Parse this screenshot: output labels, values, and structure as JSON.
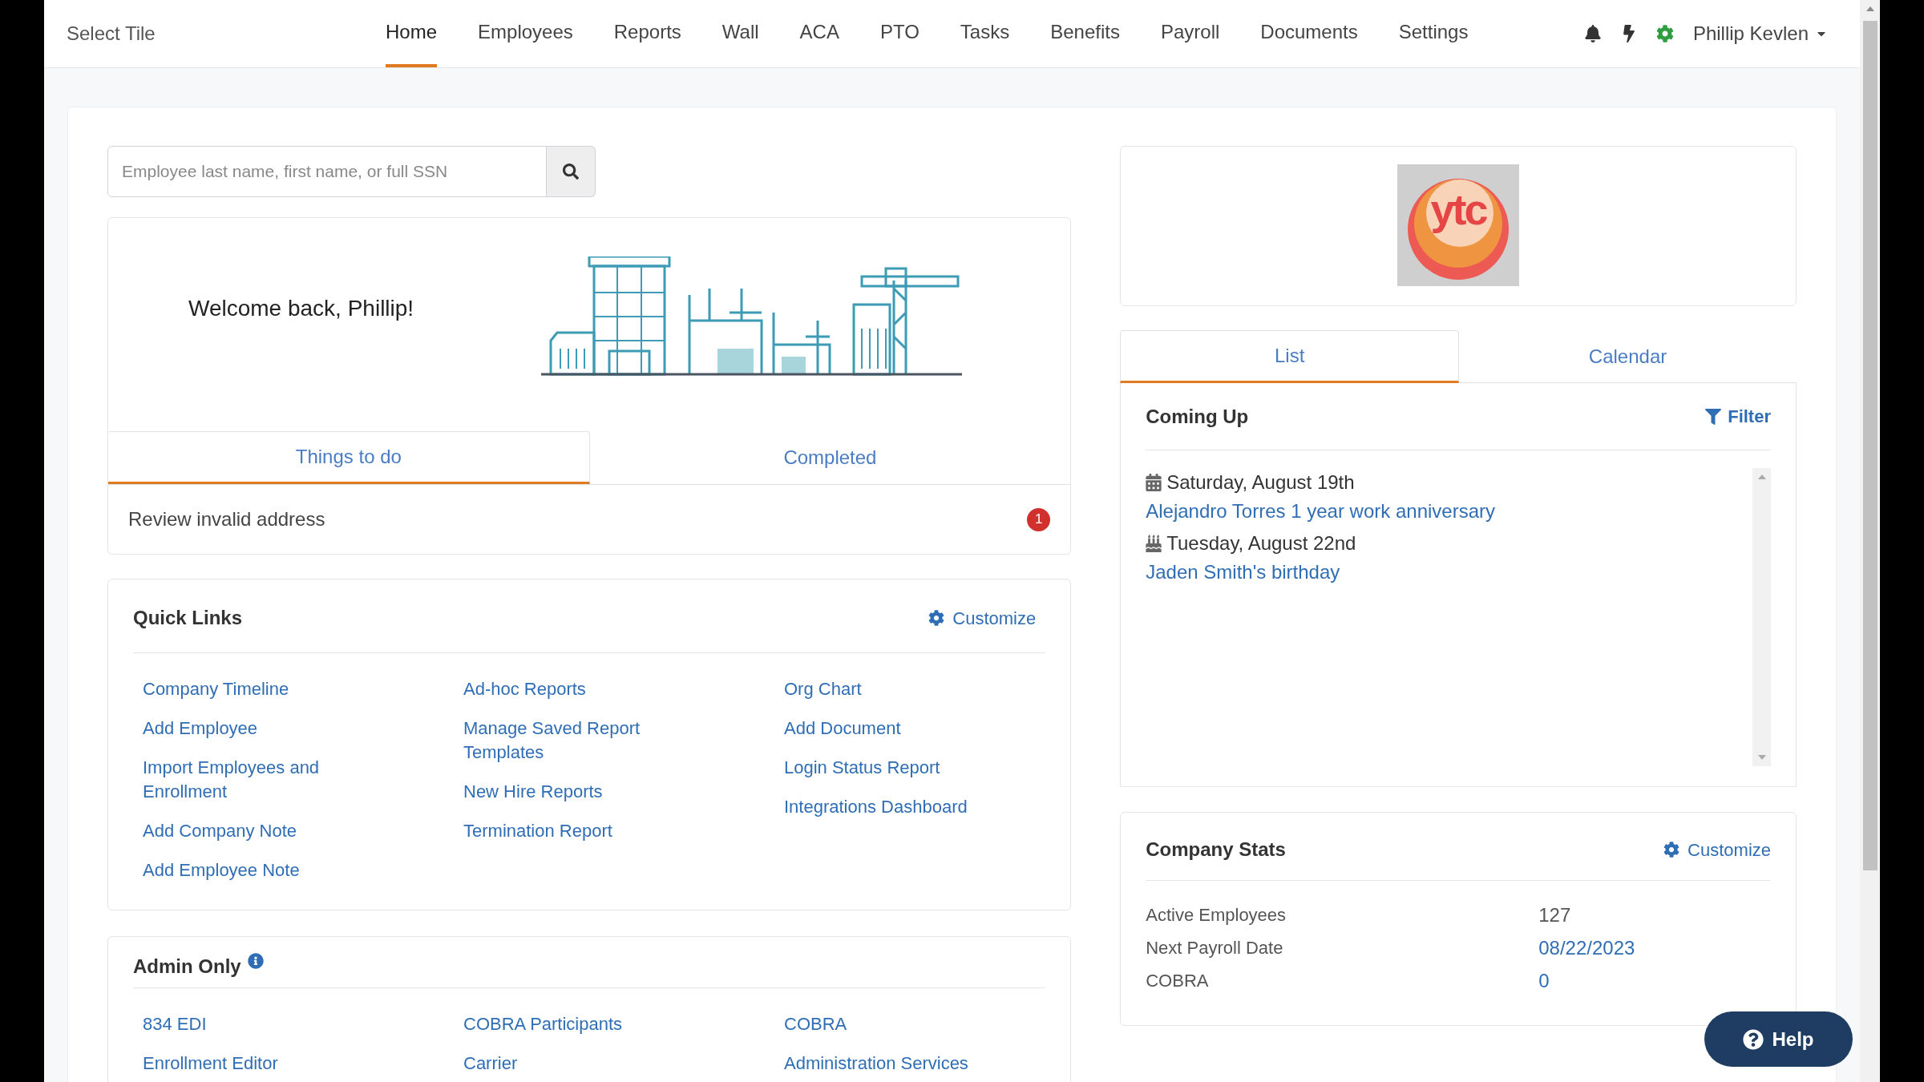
{
  "header": {
    "title": "Select Tile",
    "nav": [
      {
        "label": "Home",
        "selected": true
      },
      {
        "label": "Employees",
        "selected": false
      },
      {
        "label": "Reports",
        "selected": false
      },
      {
        "label": "Wall",
        "selected": false
      },
      {
        "label": "ACA",
        "selected": false
      },
      {
        "label": "PTO",
        "selected": false
      },
      {
        "label": "Tasks",
        "selected": false
      },
      {
        "label": "Benefits",
        "selected": false
      },
      {
        "label": "Payroll",
        "selected": false
      },
      {
        "label": "Documents",
        "selected": false
      },
      {
        "label": "Settings",
        "selected": false
      }
    ],
    "user": "Phillip Kevlen"
  },
  "search": {
    "placeholder": "Employee last name, first name, or full SSN"
  },
  "welcome": {
    "title": "Welcome back, Phillip!",
    "tabs": [
      {
        "label": "Things to do",
        "selected": true
      },
      {
        "label": "Completed",
        "selected": false
      }
    ],
    "tasks": [
      {
        "label": "Review invalid address",
        "count": "1"
      }
    ]
  },
  "quick_links": {
    "title": "Quick Links",
    "customize": "Customize",
    "columns": [
      [
        "Company Timeline",
        "Add Employee",
        "Import Employees and Enrollment",
        "Add Company Note",
        "Add Employee Note"
      ],
      [
        "Ad-hoc Reports",
        "Manage Saved Report Templates",
        "New Hire Reports",
        "Termination Report"
      ],
      [
        "Org Chart",
        "Add Document",
        "Login Status Report",
        "Integrations Dashboard"
      ]
    ]
  },
  "admin_only": {
    "title": "Admin Only",
    "columns": [
      [
        "834 EDI",
        "Enrollment Editor"
      ],
      [
        "COBRA Participants",
        "Carrier"
      ],
      [
        "COBRA",
        "Administration Services"
      ]
    ]
  },
  "logo": {
    "text": "ytc"
  },
  "events_panel": {
    "tabs": [
      {
        "label": "List",
        "selected": true
      },
      {
        "label": "Calendar",
        "selected": false
      }
    ],
    "title": "Coming Up",
    "filter": "Filter",
    "events": [
      {
        "kind": "calendar",
        "date": "Saturday, August 19th",
        "label": "Alejandro Torres 1 year work anniversary"
      },
      {
        "kind": "birthday",
        "date": "Tuesday, August 22nd",
        "label": "Jaden Smith's birthday"
      }
    ]
  },
  "company_stats": {
    "title": "Company Stats",
    "customize": "Customize",
    "rows": [
      {
        "label": "Active Employees",
        "value": "127",
        "link": false
      },
      {
        "label": "Next Payroll Date",
        "value": "08/22/2023",
        "link": true
      },
      {
        "label": "COBRA",
        "value": "0",
        "link": true
      }
    ]
  },
  "help": {
    "label": "Help"
  }
}
